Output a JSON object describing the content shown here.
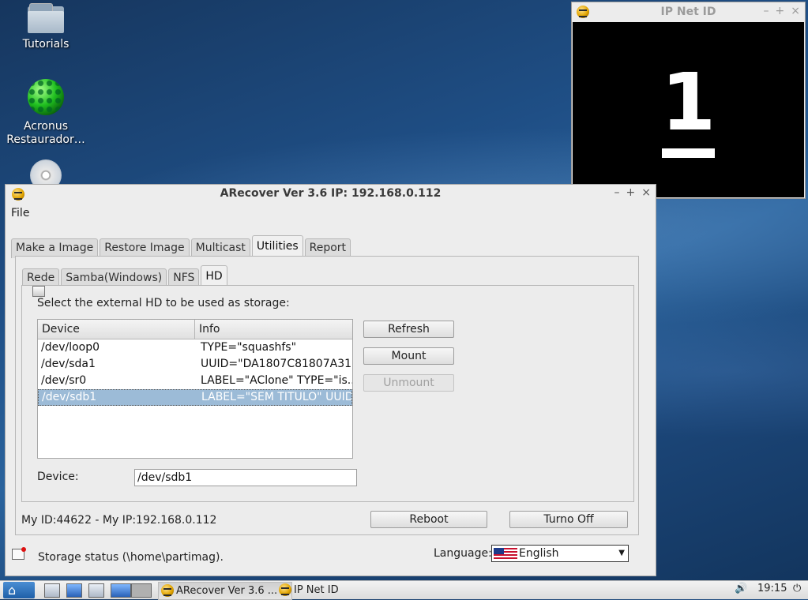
{
  "desktop": {
    "icons": [
      {
        "label": "Tutorials"
      },
      {
        "label": "Acronus\nRestaurador…"
      }
    ]
  },
  "ipnet_window": {
    "title": "IP Net ID",
    "id_number": "1"
  },
  "main_window": {
    "title": "ARecover Ver 3.6 IP: 192.168.0.112",
    "menu": {
      "file": "File"
    },
    "tabs": [
      "Make a Image",
      "Restore Image",
      "Multicast",
      "Utilities",
      "Report"
    ],
    "active_tab": "Utilities",
    "subtabs": [
      "Rede",
      "Samba(Windows)",
      "NFS",
      "HD"
    ],
    "active_subtab": "HD",
    "hd": {
      "instruction": "Select the external HD to be used as storage:",
      "columns": [
        "Device",
        "Info"
      ],
      "rows": [
        {
          "device": "/dev/loop0",
          "info": "TYPE=\"squashfs\""
        },
        {
          "device": "/dev/sda1",
          "info": "UUID=\"DA1807C81807A31..."
        },
        {
          "device": "/dev/sr0",
          "info": "LABEL=\"AClone\" TYPE=\"is..."
        },
        {
          "device": "/dev/sdb1",
          "info": "LABEL=\"SEM TITULO\" UUID..."
        }
      ],
      "selected_index": 3,
      "buttons": {
        "refresh": "Refresh",
        "mount": "Mount",
        "unmount": "Unmount"
      },
      "device_label": "Device:",
      "device_value": "/dev/sdb1"
    },
    "status": {
      "my_id_ip": "My ID:44622 - My IP:192.168.0.112",
      "reboot": "Reboot",
      "turn_off": "Turno Off",
      "storage_status": "Storage status (\\home\\partimag).",
      "language_label": "Language:",
      "language_value": "English"
    }
  },
  "taskbar": {
    "tasks": [
      {
        "label": "ARecover Ver 3.6 ..."
      },
      {
        "label": "IP Net ID"
      }
    ],
    "clock": "19:15"
  },
  "colors": {
    "selection": "#9cbbd7",
    "window_bg": "#ededed",
    "ipnet_bg": "#000000"
  }
}
